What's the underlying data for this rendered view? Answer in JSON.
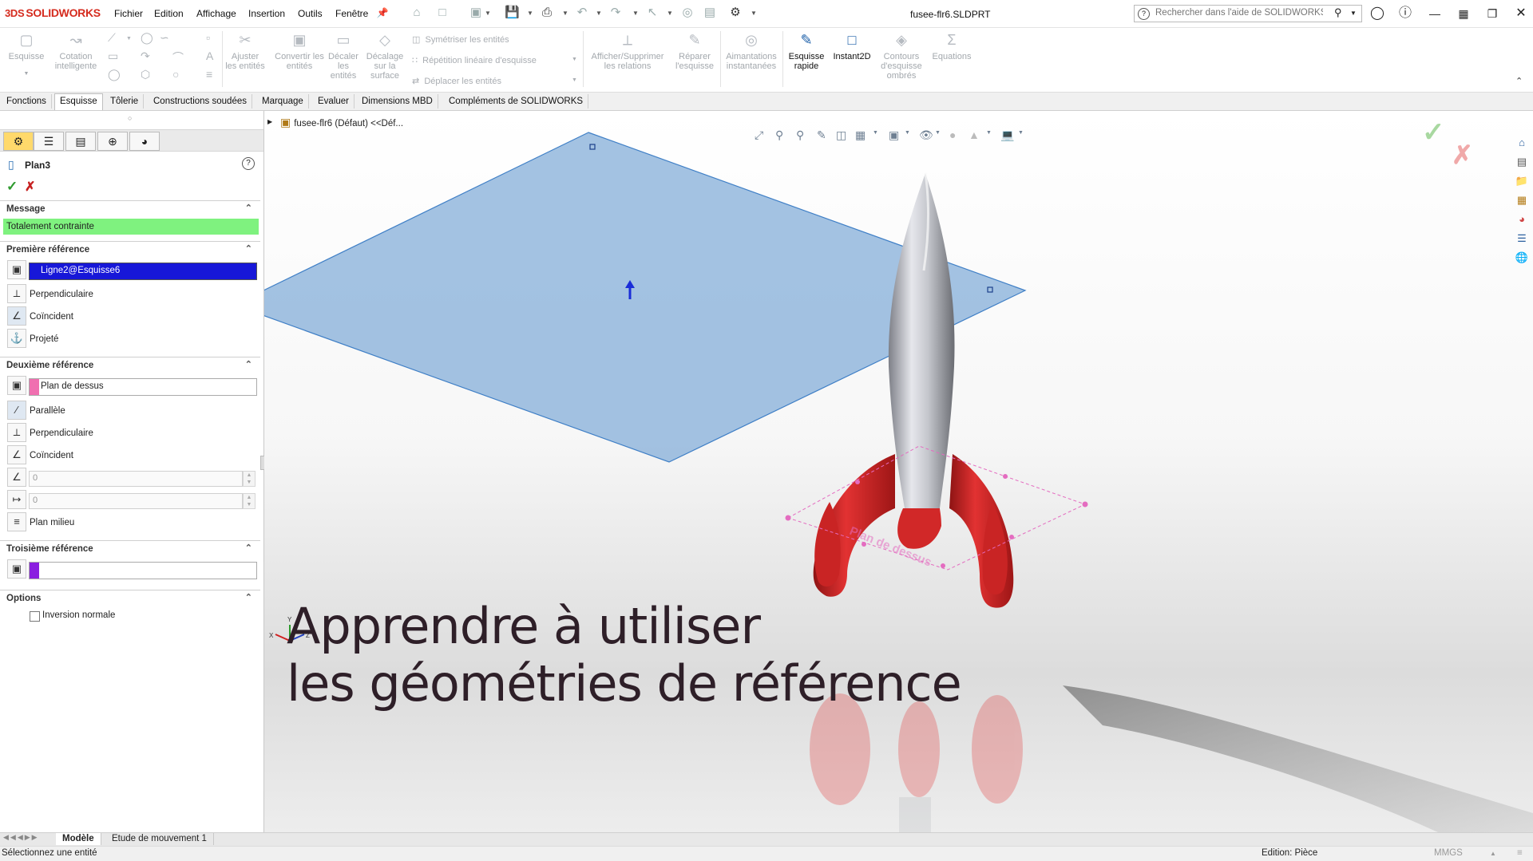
{
  "app": {
    "logo_mark": "3DS",
    "logo_text": "SOLIDWORKS",
    "menu": [
      "Fichier",
      "Edition",
      "Affichage",
      "Insertion",
      "Outils",
      "Fenêtre"
    ],
    "document_title": "fusee-flr6.SLDPRT",
    "help_search_placeholder": "Rechercher dans l'aide de SOLIDWORKS"
  },
  "ribbon": {
    "esquisse": "Esquisse",
    "cotation": "Cotation intelligente",
    "ajuster": "Ajuster les entités",
    "convertir": "Convertir les entités",
    "decaler": "Décaler les entités",
    "decalage_surface": "Décalage sur la surface",
    "symetriser": "Symétriser les entités",
    "repetition": "Répétition linéaire d'esquisse",
    "deplacer": "Déplacer les entités",
    "afficher_relations": "Afficher/Supprimer les relations",
    "reparer": "Réparer l'esquisse",
    "aimantations": "Aimantations instantanées",
    "esquisse_rapide": "Esquisse rapide",
    "instant2d": "Instant2D",
    "contours": "Contours d'esquisse ombrés",
    "equations": "Equations"
  },
  "command_tabs": [
    "Fonctions",
    "Esquisse",
    "Tôlerie",
    "Constructions soudées",
    "Marquage",
    "Evaluer",
    "Dimensions MBD",
    "Compléments de SOLIDWORKS"
  ],
  "property_manager": {
    "title": "Plan3",
    "message_section": "Message",
    "message_text": "Totalement contrainte",
    "first_ref": {
      "heading": "Première référence",
      "value": "Ligne2@Esquisse6",
      "options": [
        "Perpendiculaire",
        "Coïncident",
        "Projeté"
      ],
      "color": "#1e1ee6"
    },
    "second_ref": {
      "heading": "Deuxième référence",
      "value": "Plan de dessus",
      "options": [
        "Parallèle",
        "Perpendiculaire",
        "Coïncident"
      ],
      "angle_value": "0",
      "distance_value": "0",
      "mid_plane": "Plan milieu",
      "color": "#f06fb0"
    },
    "third_ref": {
      "heading": "Troisième référence",
      "value": "",
      "color": "#8a1fe0"
    },
    "options_section": "Options",
    "flip_normal": "Inversion normale"
  },
  "viewport": {
    "tree_root": "fusee-flr6  (Défaut) <<Déf...",
    "heading_line1": "Apprendre à utiliser",
    "heading_line2": "les géométries de référence",
    "plane_label": "Plan de dessus",
    "axis_x": "X",
    "axis_y": "Y",
    "axis_z": "Z",
    "plane_color": "#8fb4dc"
  },
  "bottom_tabs": [
    "Modèle",
    "Etude de mouvement 1"
  ],
  "status": {
    "left": "Sélectionnez une entité",
    "mode": "Edition: Pièce",
    "units": "MMGS"
  }
}
